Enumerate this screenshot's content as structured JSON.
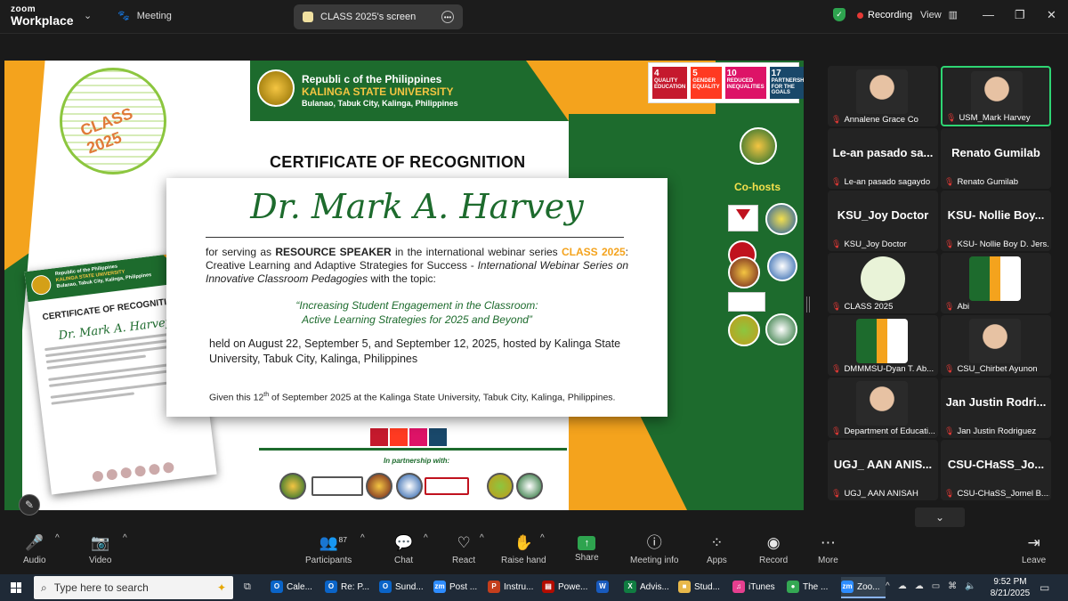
{
  "app": {
    "logo_top": "zoom",
    "logo_bottom": "Workplace",
    "meeting_label": "Meeting",
    "screen_tab": "CLASS 2025's screen",
    "recording": "Recording",
    "view": "View"
  },
  "certificate": {
    "republic": "Republi c of the Philippines",
    "university": "KALINGA STATE UNIVERSITY",
    "address": "Bulanao, Tabuk City, Kalinga, Philippines",
    "title": "CERTIFICATE OF RECOGNITION",
    "logo_text": "CLASS 2025",
    "cohosts": "Co-hosts",
    "partnership": "In partnership with:",
    "sdgs": [
      {
        "num": "4",
        "label": "QUALITY EDUCATION",
        "color": "#c5192d"
      },
      {
        "num": "5",
        "label": "GENDER EQUALITY",
        "color": "#ff3a21"
      },
      {
        "num": "10",
        "label": "REDUCED INEQUALITIES",
        "color": "#dd1367"
      },
      {
        "num": "17",
        "label": "PARTNERSHIPS FOR THE GOALS",
        "color": "#19486a"
      }
    ],
    "mini": {
      "republic": "Republic of the Philippines",
      "university": "KALINGA STATE UNIVERSITY",
      "address": "Bulanao, Tabuk City, Kalinga, Philippines",
      "title": "CERTIFICATE OF RECOGNITION",
      "name": "Dr. Mark A. Harvey"
    }
  },
  "popup": {
    "name": "Dr. Mark A. Harvey",
    "line1_a": "for serving as ",
    "line1_role": "RESOURCE SPEAKER",
    "line1_b": " in the international webinar series ",
    "line1_series": "CLASS 2025",
    "line1_c": ": Creative Learning and Adaptive Strategies for Success - ",
    "line1_italic": "International Webinar Series on Innovative Classroom Pedagogies",
    "line1_d": " with the topic:",
    "topic1": "“Increasing Student Engagement in the Classroom:",
    "topic2": "Active Learning Strategies for 2025 and Beyond”",
    "held": "held on August 22, September 5, and September 12, 2025, hosted by Kalinga State University, Tabuk City, Kalinga, Philippines",
    "given_a": "Given this 12",
    "given_sup": "th",
    "given_b": " of September 2025 at the Kalinga State University, Tabuk City, Kalinga, Philippines."
  },
  "participants": [
    {
      "name": "Annalene Grace Co",
      "big": "",
      "type": "skin"
    },
    {
      "name": "USM_Mark Harvey",
      "big": "",
      "type": "skin",
      "active": true
    },
    {
      "name": "Le-an pasado sagaydo",
      "big": "Le-an pasado sa...",
      "type": "none"
    },
    {
      "name": "Renato Gumilab",
      "big": "Renato Gumilab",
      "type": "none"
    },
    {
      "name": "KSU_Joy Doctor",
      "big": "KSU_Joy Doctor",
      "type": "none"
    },
    {
      "name": "KSU- Nollie Boy D. Jers...",
      "big": "KSU- Nollie Boy...",
      "type": "none"
    },
    {
      "name": "CLASS 2025",
      "big": "",
      "type": "class"
    },
    {
      "name": "Abi",
      "big": "",
      "type": "cert"
    },
    {
      "name": "DMMMSU-Dyan T. Ab...",
      "big": "",
      "type": "cert"
    },
    {
      "name": "CSU_Chirbet Ayunon",
      "big": "",
      "type": "skin"
    },
    {
      "name": "Department of Educati...",
      "big": "",
      "type": "skin"
    },
    {
      "name": "Jan Justin Rodriguez",
      "big": "Jan Justin Rodri...",
      "type": "none"
    },
    {
      "name": "UGJ_ AAN ANISAH",
      "big": "UGJ_ AAN ANIS...",
      "type": "none"
    },
    {
      "name": "CSU-CHaSS_Jomel B....",
      "big": "CSU-CHaSS_Jo...",
      "type": "none"
    }
  ],
  "toolbar": {
    "audio": "Audio",
    "video": "Video",
    "participants": "Participants",
    "participants_count": "87",
    "chat": "Chat",
    "react": "React",
    "raise_hand": "Raise hand",
    "share": "Share",
    "meeting_info": "Meeting info",
    "apps": "Apps",
    "record": "Record",
    "more": "More",
    "leave": "Leave"
  },
  "taskbar": {
    "search_placeholder": "Type here to search",
    "apps": [
      {
        "label": "Cale...",
        "icon": "outlook-icon",
        "color": "#0a64c8",
        "glyph": "O"
      },
      {
        "label": "Re: P...",
        "icon": "outlook-icon",
        "color": "#0a64c8",
        "glyph": "O"
      },
      {
        "label": "Sund...",
        "icon": "outlook-icon",
        "color": "#0a64c8",
        "glyph": "O"
      },
      {
        "label": "Post ...",
        "icon": "zoom-icon",
        "color": "#2d8cff",
        "glyph": "zm"
      },
      {
        "label": "Instru...",
        "icon": "powerpoint-icon",
        "color": "#c43e1c",
        "glyph": "P"
      },
      {
        "label": "Powe...",
        "icon": "pdf-icon",
        "color": "#b30b00",
        "glyph": "▤"
      },
      {
        "label": "",
        "icon": "word-icon",
        "color": "#185abd",
        "glyph": "W"
      },
      {
        "label": "Advis...",
        "icon": "excel-icon",
        "color": "#107c41",
        "glyph": "X"
      },
      {
        "label": "Stud...",
        "icon": "folder-icon",
        "color": "#e8b84a",
        "glyph": "■"
      },
      {
        "label": "iTunes",
        "icon": "itunes-icon",
        "color": "#e63f8f",
        "glyph": "♫"
      },
      {
        "label": "The ...",
        "icon": "chrome-icon",
        "color": "#34a853",
        "glyph": "●"
      },
      {
        "label": "Zoo...",
        "icon": "zoom-icon",
        "color": "#2d8cff",
        "glyph": "zm"
      }
    ],
    "time": "9:52 PM",
    "date": "8/21/2025"
  }
}
